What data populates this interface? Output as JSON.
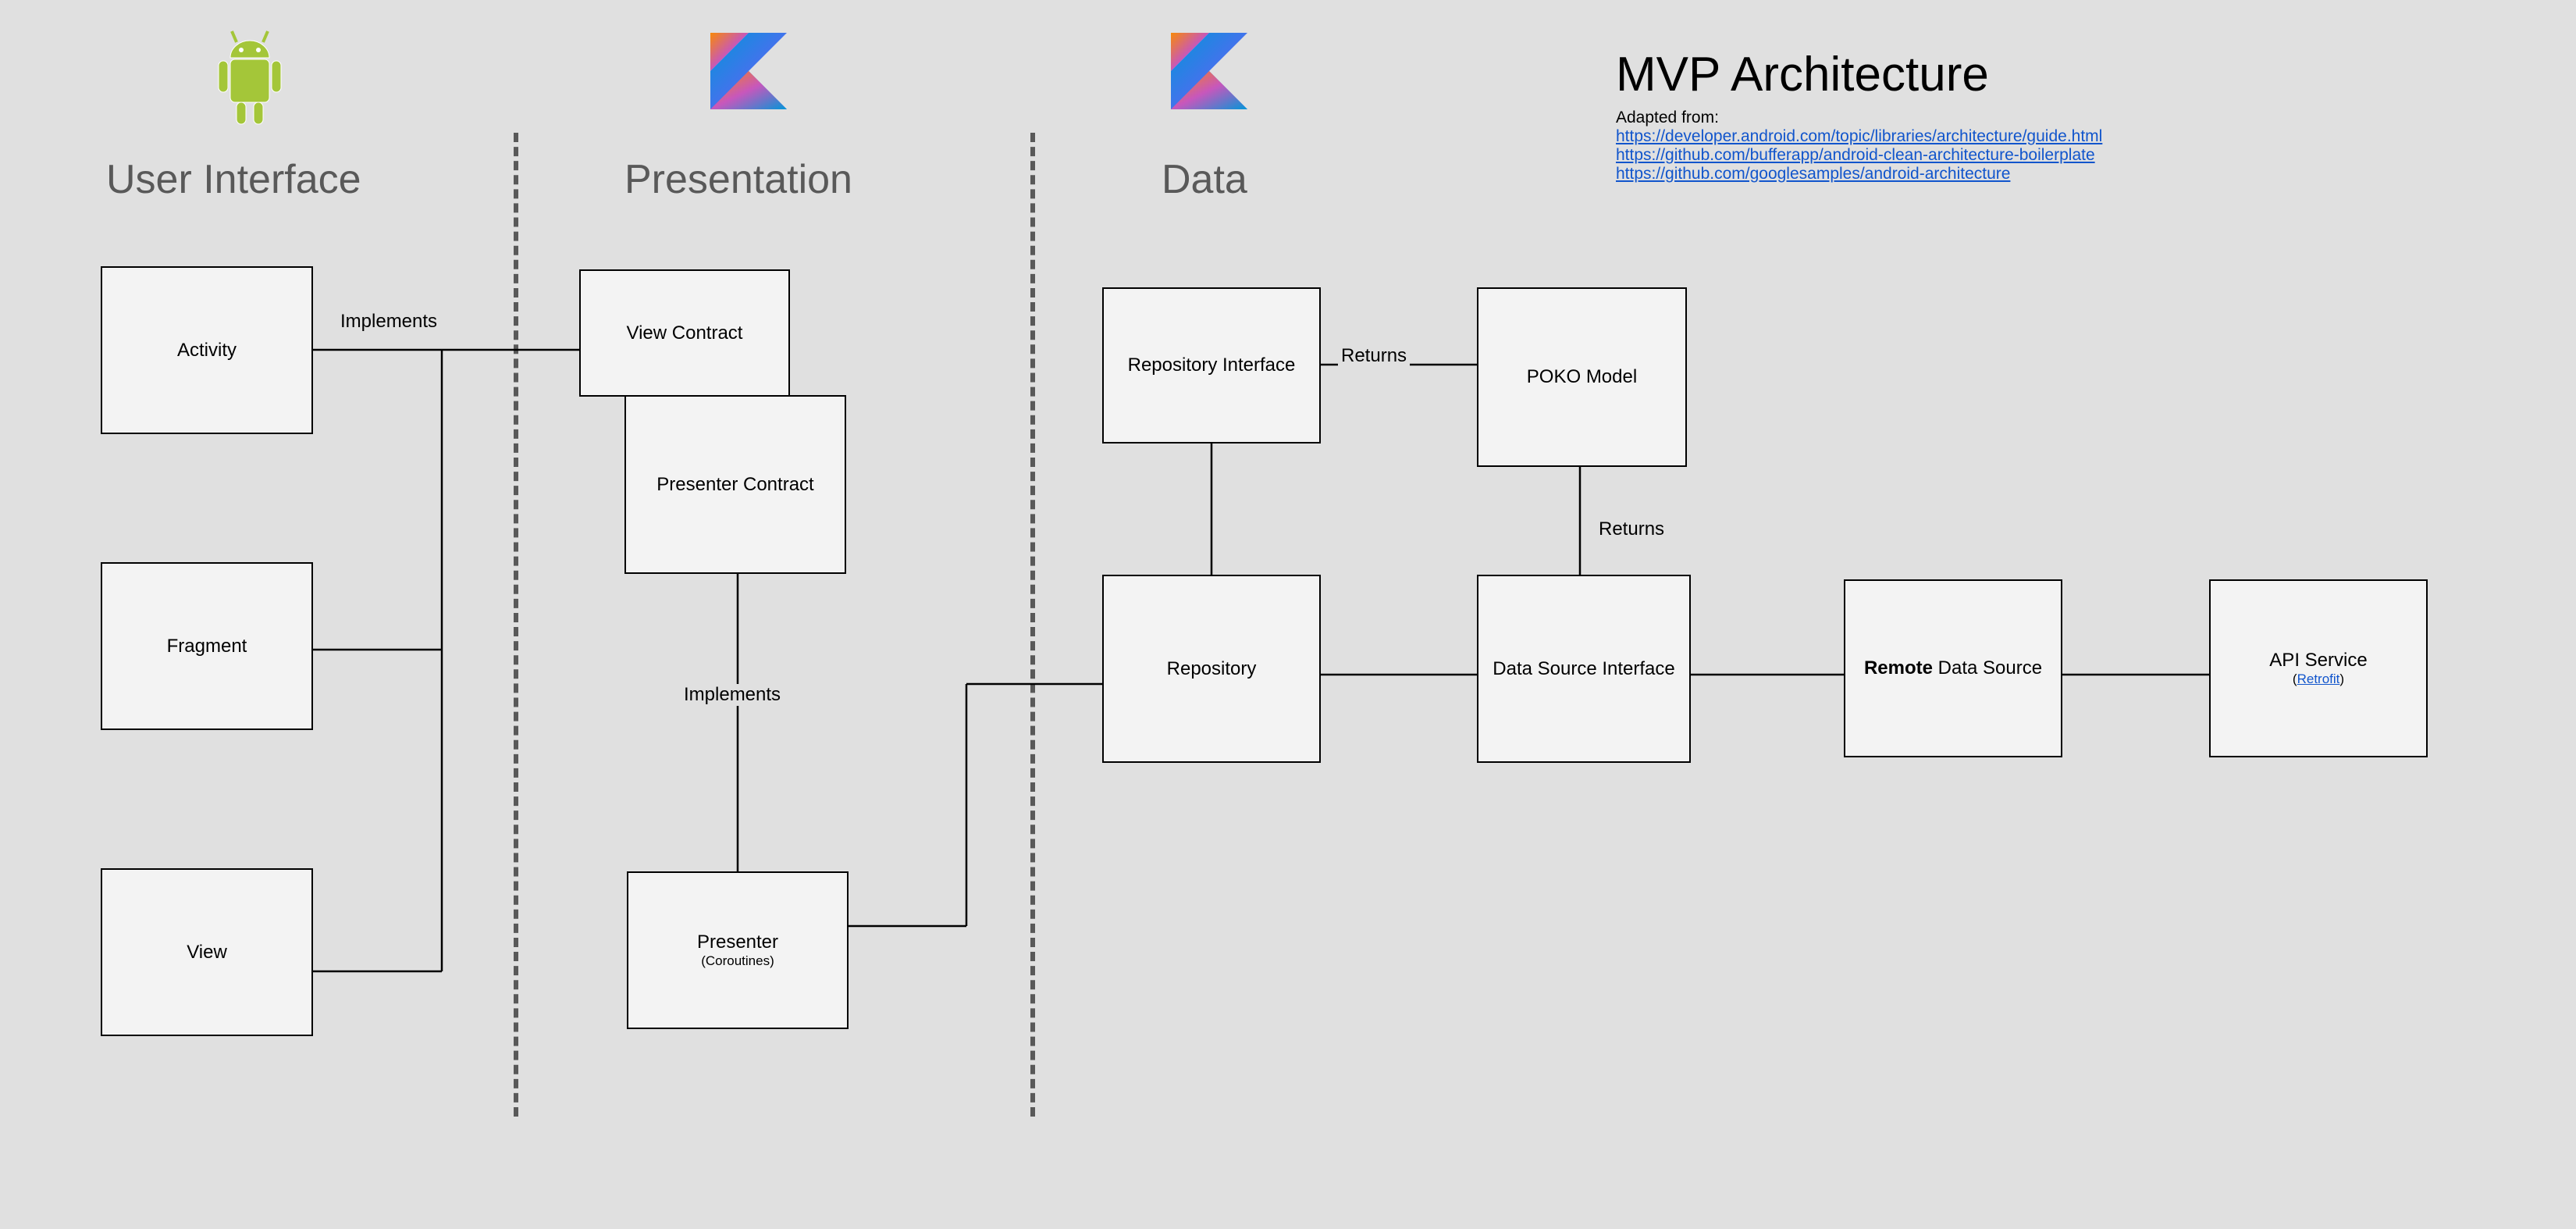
{
  "sections": {
    "ui": "User Interface",
    "presentation": "Presentation",
    "data": "Data"
  },
  "title": {
    "heading": "MVP Architecture",
    "adapted": "Adapted from:",
    "links": [
      "https://developer.android.com/topic/libraries/architecture/guide.html",
      "https://github.com/bufferapp/android-clean-architecture-boilerplate",
      "https://github.com/googlesamples/android-architecture"
    ]
  },
  "boxes": {
    "activity": "Activity",
    "fragment": "Fragment",
    "view": "View",
    "view_contract": "View Contract",
    "presenter_contract": "Presenter Contract",
    "presenter": "Presenter",
    "presenter_sub": "(Coroutines)",
    "repo_interface": "Repository Interface",
    "repository": "Repository",
    "poko": "POKO Model",
    "data_source_interface": "Data Source Interface",
    "remote_bold": "Remote",
    "remote_rest": "Data Source",
    "api": "API Service",
    "api_sub_pre": "(",
    "api_sub_link": "Retrofit",
    "api_sub_post": ")"
  },
  "edges": {
    "implements1": "Implements",
    "implements2": "Implements",
    "returns1": "Returns",
    "returns2": "Returns"
  },
  "icons": {
    "android": "android-icon",
    "kotlin1": "kotlin-icon",
    "kotlin2": "kotlin-icon"
  }
}
